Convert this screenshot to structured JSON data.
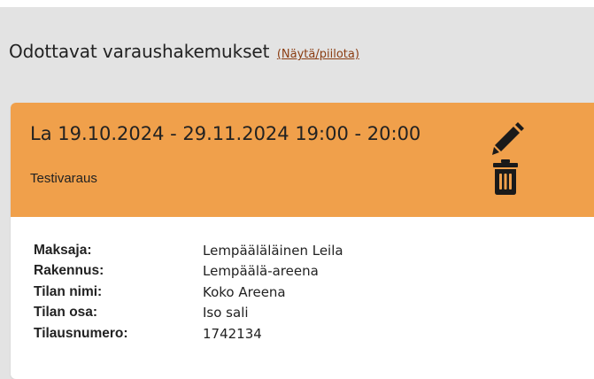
{
  "section": {
    "title": "Odottavat varaushakemukset",
    "toggle_label": "(Näytä/piilota)"
  },
  "card": {
    "date_range": "La 19.10.2024  - 29.11.2024 19:00 - 20:00",
    "subtitle": "Testivaraus",
    "edit_icon": "pencil-icon",
    "delete_icon": "trash-icon",
    "header_color": "#f0a04b",
    "details": [
      {
        "label": "Maksaja:",
        "value": "Lempääläläinen Leila"
      },
      {
        "label": "Rakennus:",
        "value": "Lempäälä-areena"
      },
      {
        "label": "Tilan nimi:",
        "value": "Koko Areena"
      },
      {
        "label": "Tilan osa:",
        "value": "Iso sali"
      },
      {
        "label": "Tilausnumero:",
        "value": "1742134"
      }
    ]
  }
}
